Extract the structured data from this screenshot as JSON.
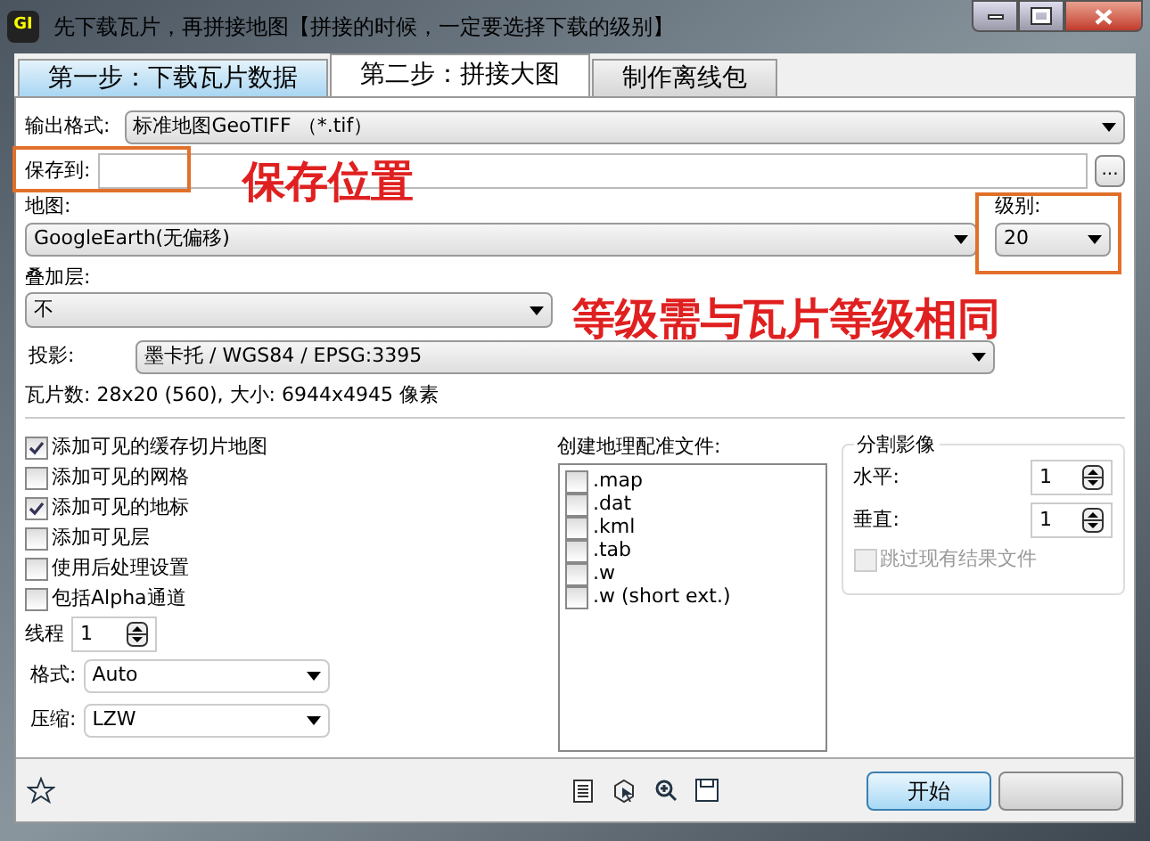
{
  "window": {
    "title": "先下载瓦片，再拼接地图【拼接的时候，一定要选择下载的级别】",
    "app_icon": "GI"
  },
  "tabs": [
    {
      "label": "第一步：下载瓦片数据",
      "selected": false
    },
    {
      "label": "第二步：拼接大图",
      "selected": true
    },
    {
      "label": "制作离线包",
      "selected": false
    }
  ],
  "output_format": {
    "label": "输出格式:",
    "value": "标准地图GeoTIFF （*.tif）"
  },
  "save_to": {
    "label": "保存到:",
    "browse": "..."
  },
  "map": {
    "label": "地图:",
    "value": "GoogleEarth(无偏移)"
  },
  "level": {
    "label": "级别:",
    "value": "20"
  },
  "overlay": {
    "label": "叠加层:",
    "value": "不"
  },
  "projection": {
    "label": "投影:",
    "value": "墨卡托 / WGS84 / EPSG:3395"
  },
  "tile_info": "瓦片数: 28x20 (560), 大小: 6944x4945 像素",
  "options": [
    {
      "label": "添加可见的缓存切片地图",
      "checked": true
    },
    {
      "label": "添加可见的网格",
      "checked": false
    },
    {
      "label": "添加可见的地标",
      "checked": true
    },
    {
      "label": "添加可见层",
      "checked": false
    },
    {
      "label": "使用后处理设置",
      "checked": false
    },
    {
      "label": "包括Alpha通道",
      "checked": false
    }
  ],
  "threads": {
    "label": "线程",
    "value": "1"
  },
  "format": {
    "label": "格式:",
    "value": "Auto"
  },
  "compression": {
    "label": "压缩:",
    "value": "LZW"
  },
  "georef": {
    "title": "创建地理配准文件:",
    "items": [
      {
        "label": ".map",
        "checked": false
      },
      {
        "label": ".dat",
        "checked": false
      },
      {
        "label": ".kml",
        "checked": false
      },
      {
        "label": ".tab",
        "checked": false
      },
      {
        "label": ".w",
        "checked": false
      },
      {
        "label": ".w (short ext.)",
        "checked": false
      }
    ]
  },
  "split": {
    "title": "分割影像",
    "horizontal": {
      "label": "水平:",
      "value": "1"
    },
    "vertical": {
      "label": "垂直:",
      "value": "1"
    },
    "skip": {
      "label": "跳过现有结果文件",
      "checked": false,
      "disabled": true
    }
  },
  "start_button": "开始",
  "annotations": [
    {
      "text": "保存位置"
    },
    {
      "text": "等级需与瓦片等级相同"
    }
  ]
}
